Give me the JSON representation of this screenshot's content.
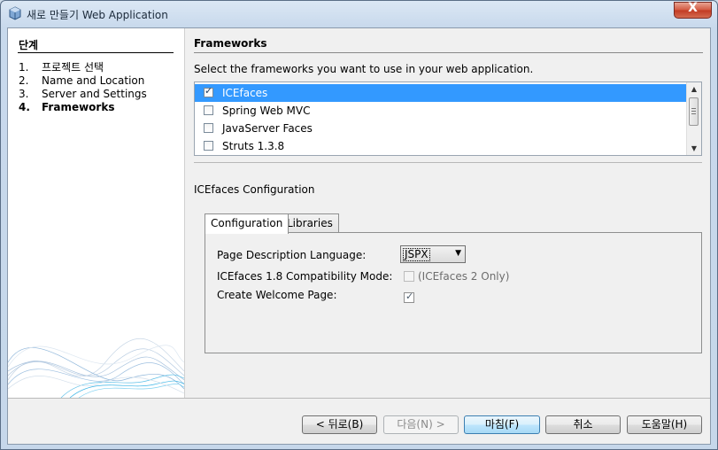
{
  "window": {
    "title": "새로 만들기 Web Application",
    "close_label": "X"
  },
  "sidebar": {
    "heading": "단계",
    "steps": [
      {
        "num": "1.",
        "label": "프로젝트 선택"
      },
      {
        "num": "2.",
        "label": "Name and Location"
      },
      {
        "num": "3.",
        "label": "Server and Settings"
      },
      {
        "num": "4.",
        "label": "Frameworks",
        "current": true
      }
    ]
  },
  "main": {
    "heading": "Frameworks",
    "instruction": "Select the frameworks you want to use in your web application.",
    "frameworks": [
      {
        "label": "ICEfaces",
        "checked": true,
        "selected": true
      },
      {
        "label": "Spring Web MVC",
        "checked": false
      },
      {
        "label": "JavaServer Faces",
        "checked": false
      },
      {
        "label": "Struts 1.3.8",
        "checked": false
      }
    ],
    "config_title": "ICEfaces Configuration",
    "tabs": [
      {
        "label": "Configuration",
        "active": true
      },
      {
        "label": "Libraries",
        "active": false
      }
    ],
    "config": {
      "pdl_label": "Page Description Language:",
      "pdl_value": "JSPX",
      "compat_label": "ICEfaces 1.8 Compatibility Mode:",
      "compat_note": "(ICEfaces 2 Only)",
      "compat_checked": false,
      "welcome_label": "Create Welcome Page:",
      "welcome_checked": true
    }
  },
  "buttons": {
    "back": "< 뒤로(B)",
    "next": "다음(N) >",
    "finish": "마침(F)",
    "cancel": "취소",
    "help": "도움말(H)"
  },
  "colors": {
    "selection": "#3399ff",
    "title_bar": "#c6d7ea",
    "default_button": "#a7d9f5"
  }
}
